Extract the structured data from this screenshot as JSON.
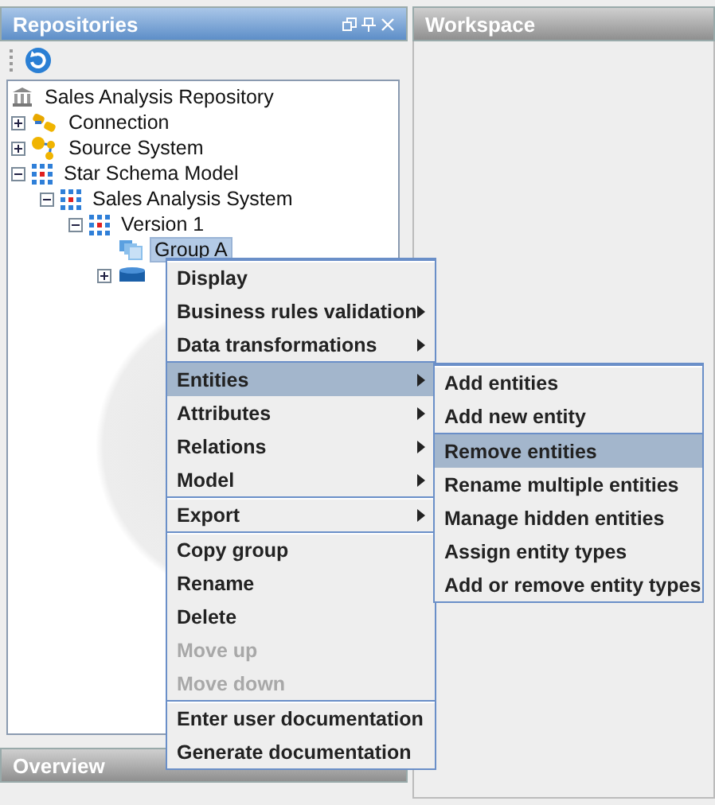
{
  "repositories_panel": {
    "title": "Repositories"
  },
  "tree": [
    {
      "label": "Sales Analysis Repository",
      "kind": "repository",
      "selected": false,
      "children": [
        {
          "label": "Connection",
          "kind": "connection",
          "expanded": false,
          "selected": false
        },
        {
          "label": "Source System",
          "kind": "source",
          "expanded": false,
          "selected": false
        },
        {
          "label": "Star Schema Model",
          "kind": "model",
          "expanded": true,
          "selected": false,
          "children": [
            {
              "label": "Sales Analysis System",
              "kind": "model",
              "expanded": true,
              "selected": false,
              "children": [
                {
                  "label": "Version 1",
                  "kind": "model",
                  "expanded": true,
                  "selected": false,
                  "children": [
                    {
                      "label": "Group A",
                      "kind": "group",
                      "selected": true
                    },
                    {
                      "kind": "table",
                      "expanded": false,
                      "selected": false
                    }
                  ]
                }
              ]
            }
          ]
        }
      ]
    }
  ],
  "workspace_panel": {
    "title": "Workspace"
  },
  "overview_panel": {
    "title": "Overview"
  },
  "context_menu": {
    "sections": [
      [
        {
          "label": "Display",
          "submenu": false,
          "disabled": false,
          "selected": false
        },
        {
          "label": "Business rules validation",
          "submenu": true,
          "disabled": false,
          "selected": false
        },
        {
          "label": "Data transformations",
          "submenu": true,
          "disabled": false,
          "selected": false
        }
      ],
      [
        {
          "label": "Entities",
          "submenu": true,
          "disabled": false,
          "selected": true
        },
        {
          "label": "Attributes",
          "submenu": true,
          "disabled": false,
          "selected": false
        },
        {
          "label": "Relations",
          "submenu": true,
          "disabled": false,
          "selected": false
        },
        {
          "label": "Model",
          "submenu": true,
          "disabled": false,
          "selected": false
        }
      ],
      [
        {
          "label": "Export",
          "submenu": true,
          "disabled": false,
          "selected": false
        }
      ],
      [
        {
          "label": "Copy group",
          "submenu": false,
          "disabled": false,
          "selected": false
        },
        {
          "label": "Rename",
          "submenu": false,
          "disabled": false,
          "selected": false
        },
        {
          "label": "Delete",
          "submenu": false,
          "disabled": false,
          "selected": false
        },
        {
          "label": "Move up",
          "submenu": false,
          "disabled": true,
          "selected": false
        },
        {
          "label": "Move down",
          "submenu": false,
          "disabled": true,
          "selected": false
        }
      ],
      [
        {
          "label": "Enter user documentation",
          "submenu": false,
          "disabled": false,
          "selected": false
        },
        {
          "label": "Generate documentation",
          "submenu": false,
          "disabled": false,
          "selected": false
        }
      ]
    ]
  },
  "submenu": {
    "sections": [
      [
        {
          "label": "Add entities",
          "submenu": false,
          "disabled": false,
          "selected": false
        },
        {
          "label": "Add new entity",
          "submenu": false,
          "disabled": false,
          "selected": false
        }
      ],
      [
        {
          "label": "Remove entities",
          "submenu": false,
          "disabled": false,
          "selected": true
        },
        {
          "label": "Rename multiple entities",
          "submenu": false,
          "disabled": false,
          "selected": false
        },
        {
          "label": "Manage hidden entities",
          "submenu": false,
          "disabled": false,
          "selected": false
        },
        {
          "label": "Assign entity types",
          "submenu": false,
          "disabled": false,
          "selected": false
        },
        {
          "label": "Add or remove entity types",
          "submenu": false,
          "disabled": false,
          "selected": false
        }
      ]
    ]
  }
}
